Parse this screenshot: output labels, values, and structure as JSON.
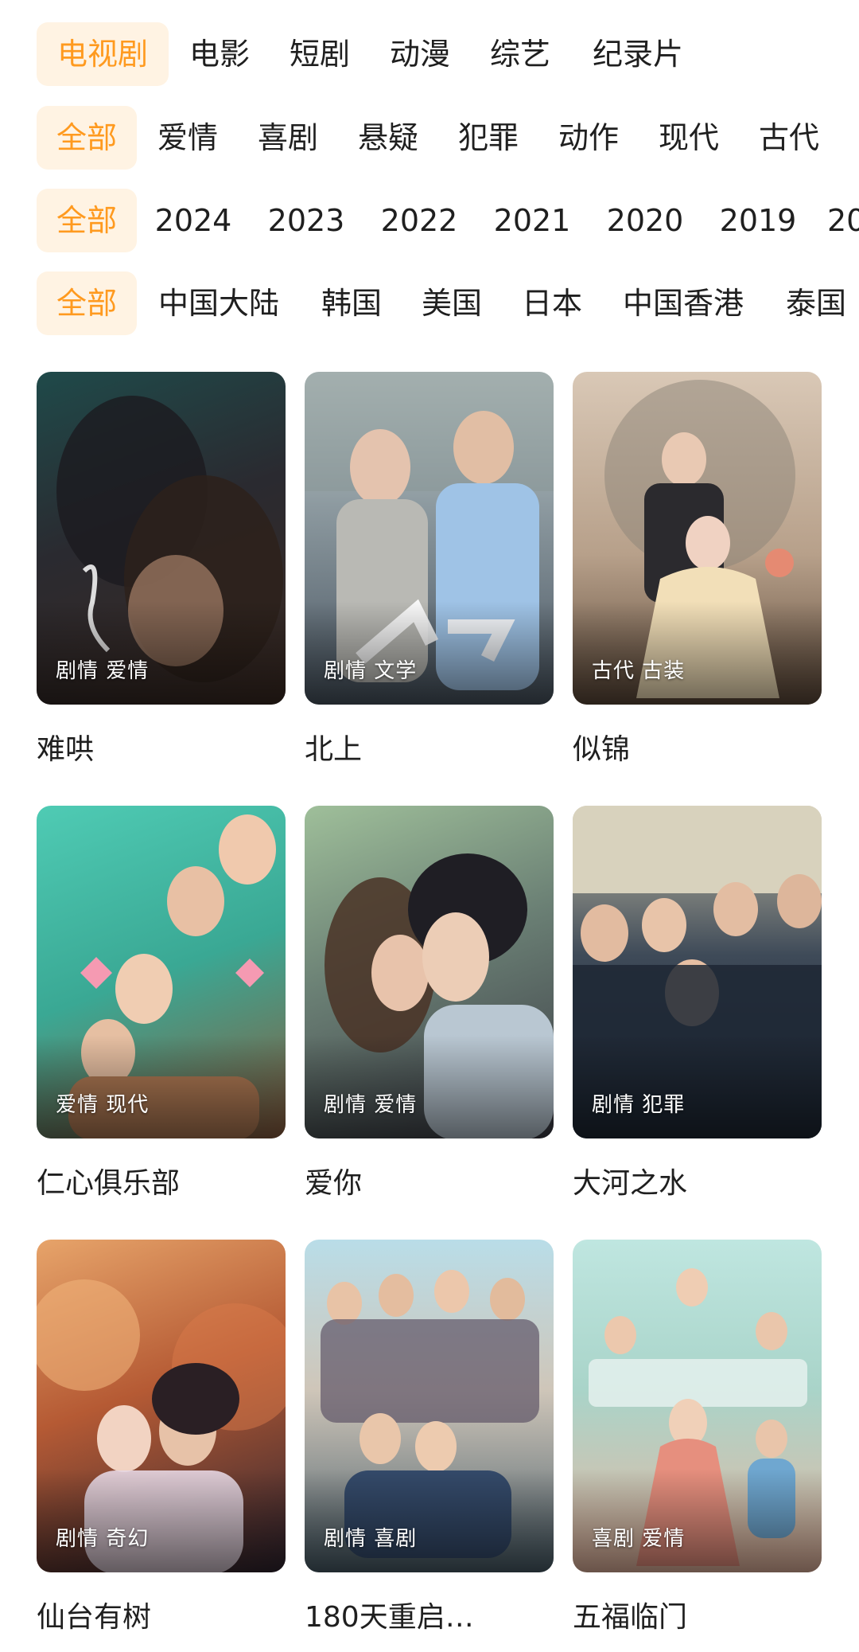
{
  "filters": {
    "categories": [
      {
        "label": "电视剧",
        "active": true
      },
      {
        "label": "电影",
        "active": false
      },
      {
        "label": "短剧",
        "active": false
      },
      {
        "label": "动漫",
        "active": false
      },
      {
        "label": "综艺",
        "active": false
      },
      {
        "label": "纪录片",
        "active": false
      }
    ],
    "genres": [
      {
        "label": "全部",
        "active": true
      },
      {
        "label": "爱情",
        "active": false
      },
      {
        "label": "喜剧",
        "active": false
      },
      {
        "label": "悬疑",
        "active": false
      },
      {
        "label": "犯罪",
        "active": false
      },
      {
        "label": "动作",
        "active": false
      },
      {
        "label": "现代",
        "active": false
      },
      {
        "label": "古代",
        "active": false
      }
    ],
    "years": [
      {
        "label": "全部",
        "active": true
      },
      {
        "label": "2024",
        "active": false
      },
      {
        "label": "2023",
        "active": false
      },
      {
        "label": "2022",
        "active": false
      },
      {
        "label": "2021",
        "active": false
      },
      {
        "label": "2020",
        "active": false
      },
      {
        "label": "2019",
        "active": false
      },
      {
        "label": "20",
        "active": false
      }
    ],
    "regions": [
      {
        "label": "全部",
        "active": true
      },
      {
        "label": "中国大陆",
        "active": false
      },
      {
        "label": "韩国",
        "active": false
      },
      {
        "label": "美国",
        "active": false
      },
      {
        "label": "日本",
        "active": false
      },
      {
        "label": "中国香港",
        "active": false
      },
      {
        "label": "泰国",
        "active": false
      }
    ]
  },
  "shows": [
    {
      "title": "难哄",
      "tags": "剧情 爱情"
    },
    {
      "title": "北上",
      "tags": "剧情 文学"
    },
    {
      "title": "似锦",
      "tags": "古代 古装"
    },
    {
      "title": "仁心俱乐部",
      "tags": "爱情 现代"
    },
    {
      "title": "爱你",
      "tags": "剧情 爱情"
    },
    {
      "title": "大河之水",
      "tags": "剧情 犯罪"
    },
    {
      "title": "仙台有树",
      "tags": "剧情 奇幻"
    },
    {
      "title": "180天重启…",
      "tags": "剧情 喜剧"
    },
    {
      "title": "五福临门",
      "tags": "喜剧 爱情"
    }
  ],
  "colors": {
    "accent": "#ff9a1f",
    "accent_bg": "#fff3e3",
    "text": "#1f1f1f"
  }
}
